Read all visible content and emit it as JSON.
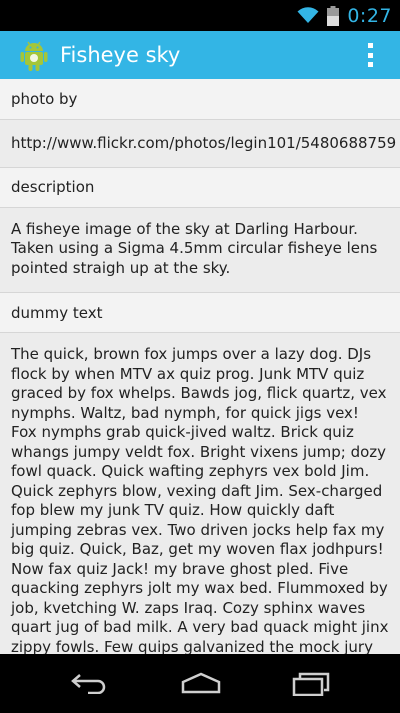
{
  "status_bar": {
    "time": "0:27",
    "wifi_icon": "wifi-icon",
    "battery_icon": "battery-icon",
    "accent_color": "#33b5e5"
  },
  "action_bar": {
    "title": "Fisheye sky",
    "app_icon": "android-icon",
    "menu_icon": "overflow-menu-icon",
    "background_color": "#33b5e5"
  },
  "sections": [
    {
      "header": "photo by",
      "body": "http://www.flickr.com/photos/legin101/5480688759"
    },
    {
      "header": "description",
      "body": "A fisheye image of the sky at Darling Harbour. Taken using a Sigma 4.5mm circular fisheye lens pointed straigh up at the sky."
    },
    {
      "header": "dummy text",
      "body": "The quick, brown fox jumps over a lazy dog. DJs flock by when MTV ax quiz prog. Junk MTV quiz graced by fox whelps. Bawds jog, flick quartz, vex nymphs. Waltz, bad nymph, for quick jigs vex! Fox nymphs grab quick-jived waltz. Brick quiz whangs jumpy veldt fox. Bright vixens jump; dozy fowl quack. Quick wafting zephyrs vex bold Jim. Quick zephyrs blow, vexing daft Jim. Sex-charged fop blew my junk TV quiz. How quickly daft jumping zebras vex. Two driven jocks help fax my big quiz. Quick, Baz, get my woven flax jodhpurs! Now fax quiz Jack! my brave ghost pled. Five quacking zephyrs jolt my wax bed. Flummoxed by job, kvetching W. zaps Iraq. Cozy sphinx waves quart jug of bad milk. A very bad quack might jinx zippy fowls. Few quips galvanized the mock jury box. Quick brown dogs jump over the lazy fox. The jay, pig, fox, zebra, and my wolves quack! Blowzy red vixens"
    }
  ],
  "nav_bar": {
    "back_icon": "back-icon",
    "home_icon": "home-icon",
    "recents_icon": "recents-icon"
  }
}
